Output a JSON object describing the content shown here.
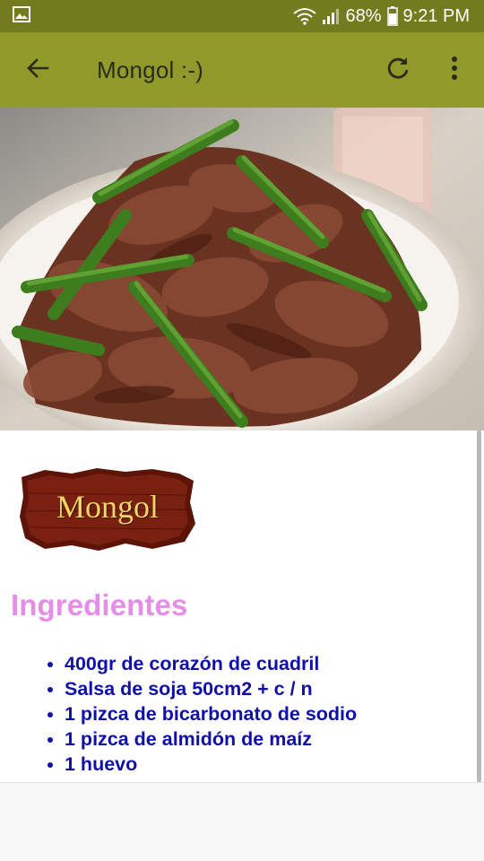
{
  "status_bar": {
    "battery": "68%",
    "time": "9:21 PM",
    "icons": [
      "image-icon",
      "wifi-icon",
      "signal-icon",
      "battery-icon"
    ]
  },
  "app_bar": {
    "title": "Mongol :-)",
    "icons": [
      "back-arrow-icon",
      "refresh-icon",
      "more-vert-icon"
    ]
  },
  "hero": {
    "image": "beef-green-beans-dish-photo"
  },
  "recipe": {
    "logo_text": "Mongol",
    "section_title": "Ingredientes",
    "ingredients": [
      "400gr de corazón de cuadril",
      "Salsa de soja 50cm2 + c / n",
      "1 pizca de bicarbonato de sodio",
      "1 pizca de almidón de maíz",
      "1 huevo"
    ]
  },
  "colors": {
    "status_bar": "#727c1f",
    "app_bar": "#8f9a2a",
    "section_title": "#e58de8",
    "ingredient_text": "#1010a8"
  }
}
